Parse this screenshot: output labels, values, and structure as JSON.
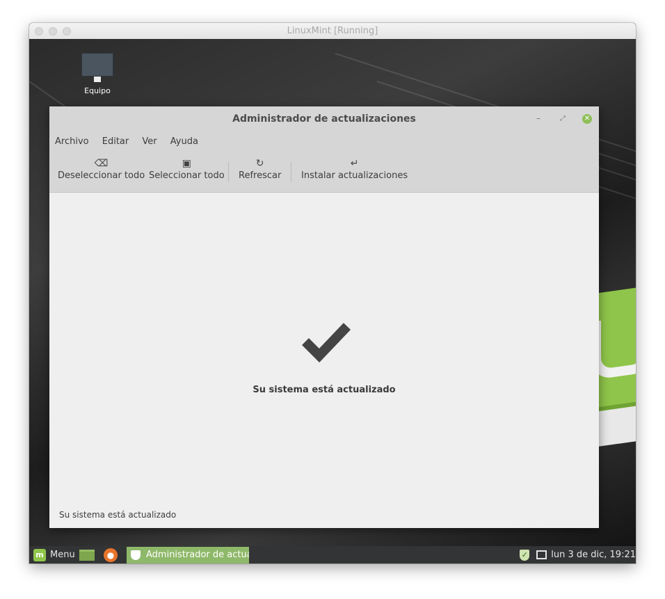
{
  "vm": {
    "title": "LinuxMint [Running]"
  },
  "desktop": {
    "icon_label": "Equipo"
  },
  "app": {
    "title": "Administrador de actualizaciones",
    "menu": [
      "Archivo",
      "Editar",
      "Ver",
      "Ayuda"
    ],
    "toolbar": {
      "deselect": "Deseleccionar todo",
      "select": "Seleccionar todo",
      "refresh": "Refrescar",
      "install": "Instalar actualizaciones"
    },
    "message": "Su sistema está actualizado",
    "status": "Su sistema está actualizado"
  },
  "taskbar": {
    "menu_label": "Menu",
    "task_label": "Administrador de actual...",
    "clock": "lun  3 de dic, 19:21"
  },
  "colors": {
    "accent": "#8fbf5a",
    "taskbar": "#333435"
  }
}
